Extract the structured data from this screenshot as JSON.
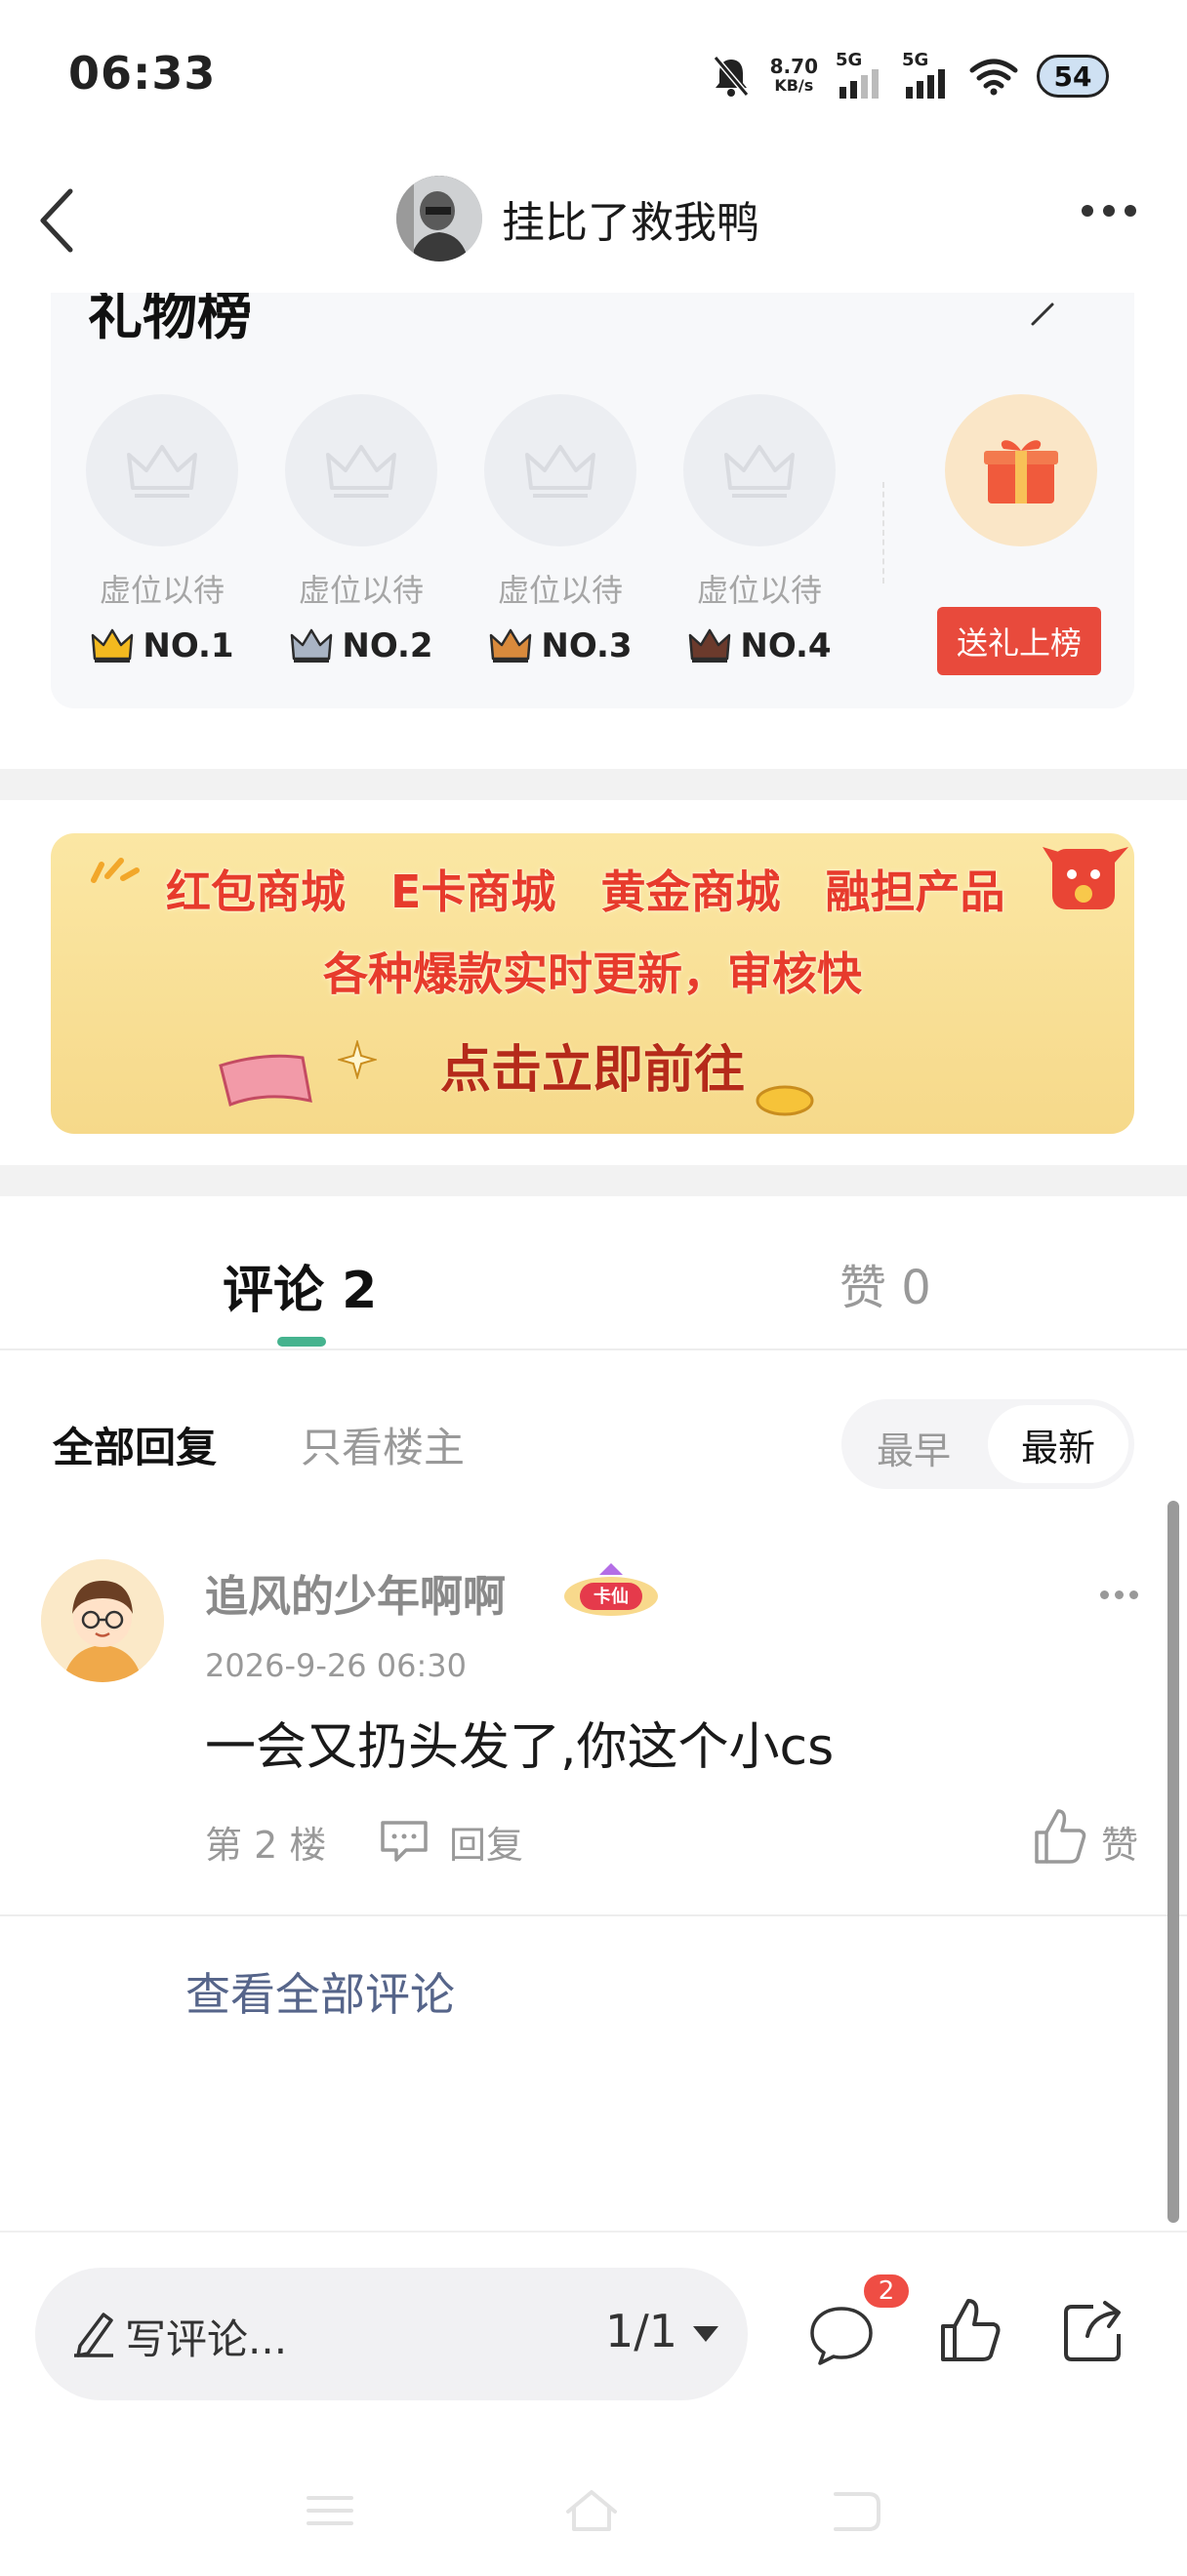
{
  "status_bar": {
    "time": "06:33",
    "net_speed_value": "8.70",
    "net_speed_unit": "KB/s",
    "signal_1_label": "5G",
    "signal_2_label": "5G",
    "battery": "54",
    "icons": [
      "mute-bell-icon",
      "signal-icon",
      "signal-icon",
      "wifi-icon",
      "battery-icon"
    ]
  },
  "header": {
    "title": "挂比了救我鸭",
    "icons": [
      "back-icon",
      "avatar",
      "more-icon"
    ]
  },
  "gift_list": {
    "title": "礼物榜",
    "slots": [
      {
        "label": "虚位以待",
        "rank": "NO.1",
        "crown_color": "#f3b91f"
      },
      {
        "label": "虚位以待",
        "rank": "NO.2",
        "crown_color": "#a9b4c4"
      },
      {
        "label": "虚位以待",
        "rank": "NO.3",
        "crown_color": "#d98a3c"
      },
      {
        "label": "虚位以待",
        "rank": "NO.4",
        "crown_color": "#6b3a2c"
      }
    ],
    "send_button": "送礼上榜",
    "accent": "#e84a3c"
  },
  "banner": {
    "row1": [
      "红包商城",
      "E卡商城",
      "黄金商城",
      "融担产品"
    ],
    "row2": "各种爆款实时更新，审核快",
    "row3": "点击立即前往"
  },
  "tabs": {
    "comments": "评论 2",
    "likes": "赞 0",
    "indicator_color": "#45b38e"
  },
  "filter": {
    "all": "全部回复",
    "owner_only": "只看楼主",
    "sort_earliest": "最早",
    "sort_newest": "最新"
  },
  "comment": {
    "author": "追风的少年啊啊",
    "badge": "卡仙",
    "time": "2026-9-26 06:30",
    "text": "一会又扔头发了,你这个小cs",
    "floor": "第 2 楼",
    "reply": "回复",
    "like": "赞"
  },
  "view_all": "查看全部评论",
  "bottom_bar": {
    "placeholder": "写评论...",
    "page": "1/1",
    "comment_count": "2"
  }
}
